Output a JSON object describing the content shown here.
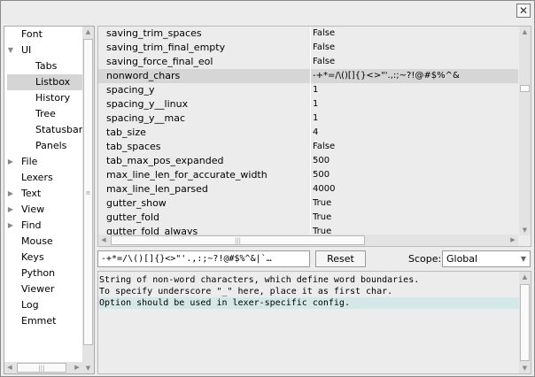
{
  "window": {
    "close_label": "✕"
  },
  "tree": {
    "items": [
      {
        "label": "Font",
        "level": 0,
        "arrow": ""
      },
      {
        "label": "UI",
        "level": 0,
        "arrow": "down"
      },
      {
        "label": "Tabs",
        "level": 1,
        "arrow": ""
      },
      {
        "label": "Listbox",
        "level": 1,
        "arrow": "",
        "selected": true
      },
      {
        "label": "History",
        "level": 1,
        "arrow": ""
      },
      {
        "label": "Tree",
        "level": 1,
        "arrow": ""
      },
      {
        "label": "Statusbar",
        "level": 1,
        "arrow": ""
      },
      {
        "label": "Panels",
        "level": 1,
        "arrow": ""
      },
      {
        "label": "File",
        "level": 0,
        "arrow": "right"
      },
      {
        "label": "Lexers",
        "level": 0,
        "arrow": ""
      },
      {
        "label": "Text",
        "level": 0,
        "arrow": "right"
      },
      {
        "label": "View",
        "level": 0,
        "arrow": "right"
      },
      {
        "label": "Find",
        "level": 0,
        "arrow": "right"
      },
      {
        "label": "Mouse",
        "level": 0,
        "arrow": ""
      },
      {
        "label": "Keys",
        "level": 0,
        "arrow": ""
      },
      {
        "label": "Python",
        "level": 0,
        "arrow": ""
      },
      {
        "label": "Viewer",
        "level": 0,
        "arrow": ""
      },
      {
        "label": "Log",
        "level": 0,
        "arrow": ""
      },
      {
        "label": "Emmet",
        "level": 0,
        "arrow": ""
      }
    ]
  },
  "options": {
    "rows": [
      {
        "name": "saving_trim_spaces",
        "value": "False"
      },
      {
        "name": "saving_trim_final_empty",
        "value": "False"
      },
      {
        "name": "saving_force_final_eol",
        "value": "False"
      },
      {
        "name": "nonword_chars",
        "value": "-+*=/\\()[]{}<>\"'.,:;~?!@#$%^&",
        "selected": true
      },
      {
        "name": "spacing_y",
        "value": "1"
      },
      {
        "name": "spacing_y__linux",
        "value": "1"
      },
      {
        "name": "spacing_y__mac",
        "value": "1"
      },
      {
        "name": "tab_size",
        "value": "4"
      },
      {
        "name": "tab_spaces",
        "value": "False"
      },
      {
        "name": "tab_max_pos_expanded",
        "value": "500"
      },
      {
        "name": "max_line_len_for_accurate_width",
        "value": "500"
      },
      {
        "name": "max_line_len_parsed",
        "value": "4000"
      },
      {
        "name": "gutter_show",
        "value": "True"
      },
      {
        "name": "gutter_fold",
        "value": "True"
      },
      {
        "name": "gutter_fold_always",
        "value": "True"
      }
    ]
  },
  "editor": {
    "value": "-+*=/\\()[]{}<>\"'.,:;~?!@#$%^&|`…",
    "reset_label": "Reset",
    "scope_label": "Scope:",
    "scope_value": "Global"
  },
  "info": {
    "lines": [
      "String of non-word characters, which define word boundaries.",
      "To specify underscore \"_\" here, place it as first char.",
      "Option should be used in lexer-specific config."
    ]
  },
  "icons": {
    "arrow_up": "▲",
    "arrow_down": "▼",
    "arrow_left": "◀",
    "arrow_right": "▶",
    "tree_expanded": "▼",
    "tree_collapsed": "▶",
    "grip": "≡",
    "grip_h": "|||"
  }
}
